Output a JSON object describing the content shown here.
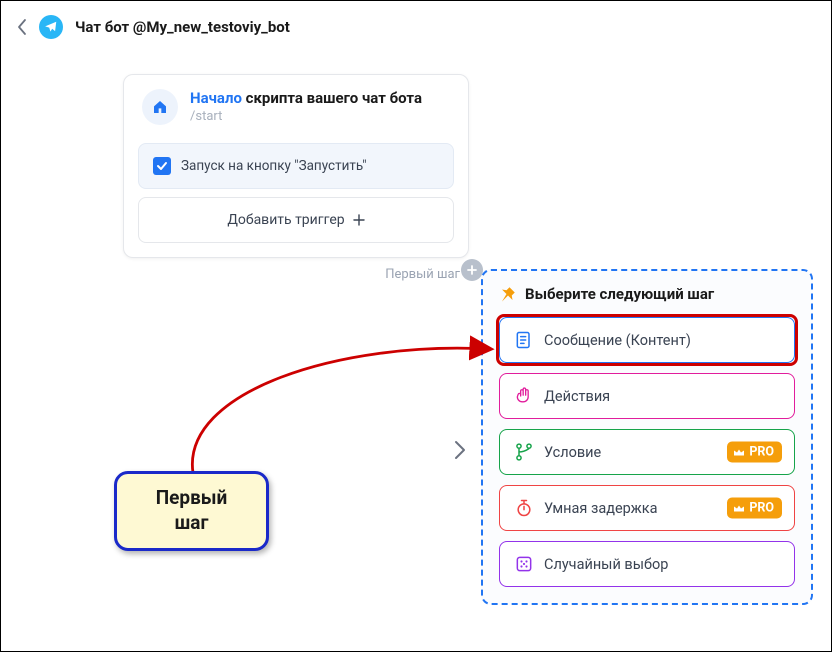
{
  "header": {
    "title": "Чат бот @My_new_testoviy_bot"
  },
  "startCard": {
    "titleHighlight": "Начало",
    "titleRest": " скрипта вашего чат бота",
    "subtitle": "/start",
    "triggerLabel": "Запуск на кнопку \"Запустить\"",
    "addTriggerLabel": "Добавить триггер",
    "firstStepLabel": "Первый шаг"
  },
  "chooser": {
    "title": "Выберите следующий шаг",
    "options": {
      "message": "Сообщение (Контент)",
      "actions": "Действия",
      "condition": "Условие",
      "delay": "Умная задержка",
      "random": "Случайный выбор"
    },
    "proBadge": "PRO"
  },
  "callout": {
    "line1": "Первый",
    "line2": "шаг"
  }
}
